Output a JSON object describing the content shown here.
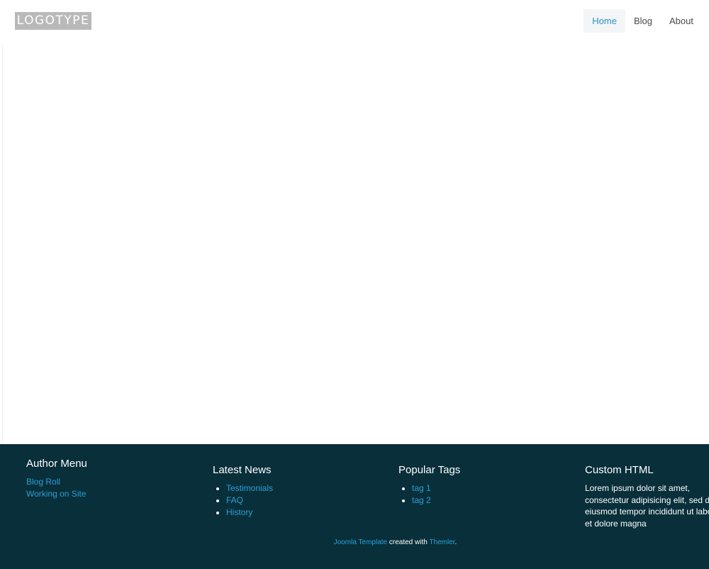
{
  "header": {
    "logo_text": "LOGOTYPE",
    "nav": [
      {
        "label": "Home",
        "active": true
      },
      {
        "label": "Blog",
        "active": false
      },
      {
        "label": "About",
        "active": false
      }
    ]
  },
  "footer": {
    "author_menu": {
      "title": "Author Menu",
      "links": [
        "Blog Roll",
        "Working on Site"
      ]
    },
    "latest_news": {
      "title": "Latest News",
      "items": [
        "Testimonials",
        "FAQ",
        "History"
      ]
    },
    "popular_tags": {
      "title": "Popular Tags",
      "items": [
        "tag 1",
        "tag 2"
      ]
    },
    "custom_html": {
      "title": "Custom HTML",
      "text": "Lorem ipsum dolor sit amet, consectetur adipisicing elit, sed do eiusmod tempor incididunt ut labore et dolore magna"
    },
    "copyright": {
      "template_link": "Joomla Template",
      "middle_text": " created with ",
      "themler_link": "Themler",
      "end_text": "."
    }
  },
  "colors": {
    "footer_background": "#082f3a",
    "link": "#2b9fd6",
    "nav_active_text": "#2b94c6",
    "nav_active_background": "#f4f5f6",
    "logo_background": "#b9b9b9"
  }
}
